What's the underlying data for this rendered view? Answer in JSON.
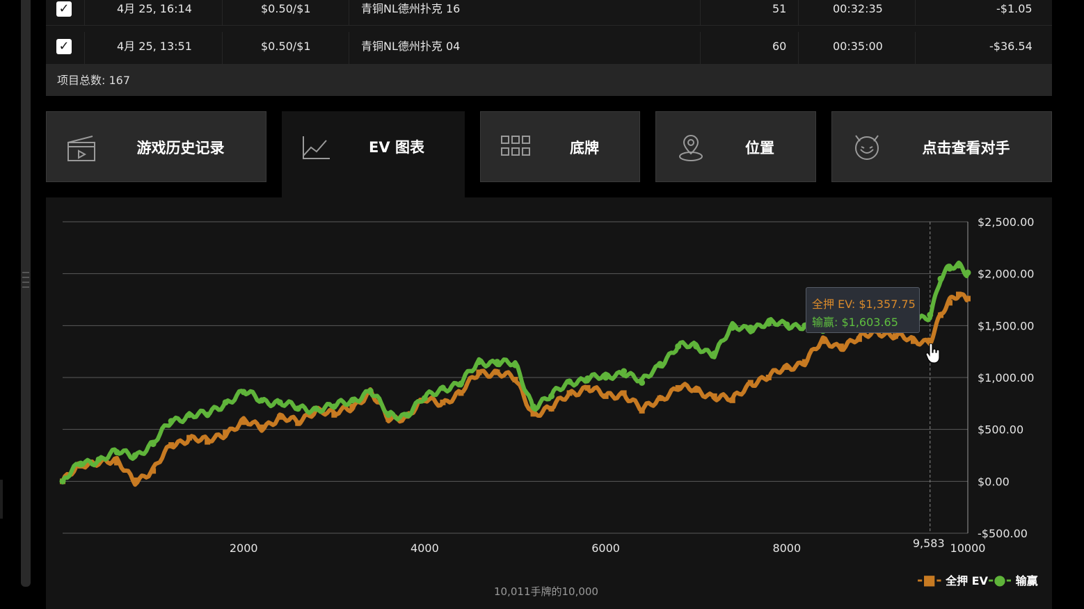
{
  "table": {
    "rows": [
      {
        "date": "4月 25, 16:14",
        "stakes": "$0.50/$1",
        "table": "青铜NL德州扑克 16",
        "hands": "51",
        "duration": "00:32:35",
        "result": "-$1.05"
      },
      {
        "date": "4月 25, 13:51",
        "stakes": "$0.50/$1",
        "table": "青铜NL德州扑克 04",
        "hands": "60",
        "duration": "00:35:00",
        "result": "-$36.54"
      }
    ],
    "footer": "项目总数: 167"
  },
  "tabs": [
    {
      "label": "游戏历史记录",
      "icon": "history-icon"
    },
    {
      "label": "EV 图表",
      "icon": "chart-icon"
    },
    {
      "label": "底牌",
      "icon": "grid-icon"
    },
    {
      "label": "位置",
      "icon": "position-icon"
    },
    {
      "label": "点击查看对手",
      "icon": "opponent-icon"
    }
  ],
  "chart": {
    "tooltip_ev": "全押 EV: $1,357.75",
    "tooltip_win": "输赢: $1,603.65",
    "hover_x_label": "9,583",
    "legend_ev": "全押 EV",
    "legend_win": "输赢",
    "hands_note": "10,011手牌的10,000"
  },
  "colors": {
    "ev": "#c77a22",
    "win": "#5fb43a",
    "grid": "#5a5a5a"
  },
  "chart_data": {
    "type": "line",
    "xlim": [
      0,
      10000
    ],
    "ylim": [
      -500,
      2500
    ],
    "x_ticks": [
      "2000",
      "4000",
      "6000",
      "8000",
      "10000"
    ],
    "y_ticks": [
      "$2,500.00",
      "$2,000.00",
      "$1,500.00",
      "$1,000.00",
      "$500.00",
      "$0.00",
      "-$500.00"
    ],
    "x": [
      0,
      200,
      400,
      600,
      800,
      1000,
      1200,
      1400,
      1600,
      1800,
      2000,
      2200,
      2400,
      2600,
      2800,
      3000,
      3200,
      3400,
      3600,
      3800,
      4000,
      4200,
      4400,
      4600,
      4800,
      5000,
      5200,
      5400,
      5600,
      5800,
      6000,
      6200,
      6400,
      6600,
      6800,
      7000,
      7200,
      7400,
      7600,
      7800,
      8000,
      8200,
      8400,
      8600,
      8800,
      9000,
      9200,
      9400,
      9583,
      9700,
      9800,
      9900,
      10000
    ],
    "series": [
      {
        "name": "全押 EV",
        "values": [
          0,
          150,
          200,
          180,
          10,
          100,
          350,
          420,
          380,
          470,
          570,
          520,
          620,
          560,
          700,
          640,
          720,
          860,
          600,
          630,
          780,
          760,
          850,
          1050,
          1050,
          980,
          650,
          700,
          850,
          900,
          820,
          850,
          680,
          800,
          900,
          880,
          820,
          780,
          950,
          1000,
          1100,
          1150,
          1350,
          1300,
          1370,
          1450,
          1400,
          1350,
          1357,
          1600,
          1720,
          1800,
          1760
        ]
      },
      {
        "name": "输赢",
        "values": [
          0,
          170,
          210,
          280,
          250,
          360,
          580,
          640,
          640,
          760,
          860,
          780,
          760,
          700,
          700,
          720,
          780,
          870,
          640,
          640,
          800,
          900,
          940,
          1150,
          1150,
          1120,
          720,
          820,
          960,
          990,
          1000,
          1060,
          950,
          1130,
          1300,
          1300,
          1230,
          1480,
          1480,
          1520,
          1510,
          1500,
          1450,
          1550,
          1560,
          1500,
          1530,
          1560,
          1603,
          1950,
          2050,
          2080,
          2010
        ]
      }
    ]
  }
}
